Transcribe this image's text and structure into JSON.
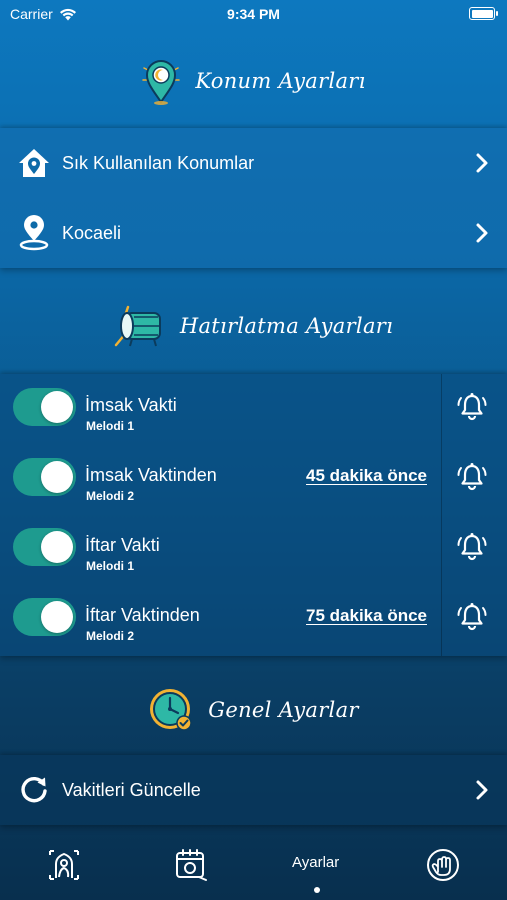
{
  "status_bar": {
    "carrier": "Carrier",
    "time": "9:34 PM"
  },
  "sections": {
    "location": {
      "title": "Konum Ayarları",
      "icon": "location-pin-icon"
    },
    "reminders": {
      "title": "Hatırlatma Ayarları",
      "icon": "drum-icon"
    },
    "general": {
      "title": "Genel Ayarlar",
      "icon": "clock-icon"
    }
  },
  "location_rows": [
    {
      "label": "Sık Kullanılan Konumlar",
      "icon": "house-pin-icon"
    },
    {
      "label": "Kocaeli",
      "icon": "map-pin-icon"
    }
  ],
  "reminders": [
    {
      "name": "İmsak Vakti",
      "melody": "Melodi 1",
      "offset": "",
      "enabled": true
    },
    {
      "name": "İmsak Vaktinden",
      "melody": "Melodi 2",
      "offset": "45 dakika önce",
      "enabled": true
    },
    {
      "name": "İftar Vakti",
      "melody": "Melodi 1",
      "offset": "",
      "enabled": true
    },
    {
      "name": "İftar Vaktinden",
      "melody": "Melodi 2",
      "offset": "75 dakika önce",
      "enabled": true
    }
  ],
  "general_rows": [
    {
      "label": "Vakitleri Güncelle",
      "icon": "refresh-icon"
    }
  ],
  "tab_bar": {
    "active_label": "Ayarlar",
    "tabs": [
      "prayer-icon",
      "calendar-icon",
      "settings-tab",
      "hand-icon"
    ]
  },
  "colors": {
    "toggle_on": "#1e9b8f",
    "accent_teal": "#2eb8a6",
    "accent_gold": "#f2b233"
  }
}
